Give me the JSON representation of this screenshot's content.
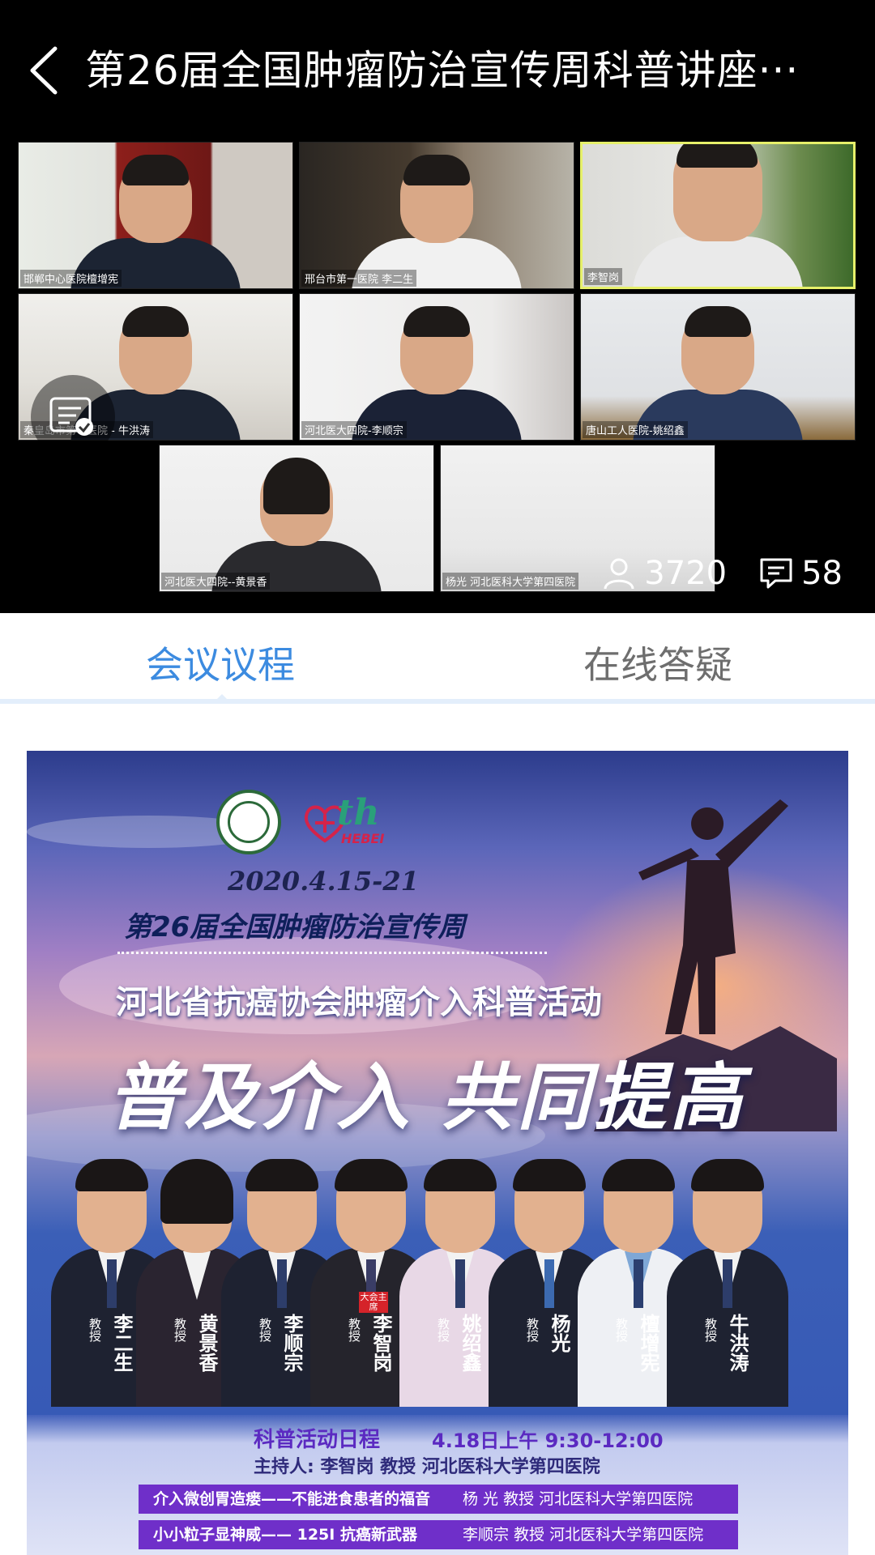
{
  "header": {
    "back_label": "返回",
    "title": "第26届全国肿瘤防治宣传周科普讲座···"
  },
  "video": {
    "tiles": [
      {
        "label": "邯郸中心医院檀增宪",
        "speaking": false
      },
      {
        "label": "邢台市第一医院 李二生",
        "speaking": false
      },
      {
        "label": "李智岗",
        "speaking": true
      },
      {
        "label": "秦皇岛市第一医院 - 牛洪涛",
        "speaking": false
      },
      {
        "label": "河北医大四院-李顺宗",
        "speaking": false
      },
      {
        "label": "唐山工人医院-姚绍鑫",
        "speaking": false
      },
      {
        "label": "河北医大四院--黄景香",
        "speaking": false
      },
      {
        "label": "杨光   河北医科大学第四医院",
        "speaking": false
      }
    ],
    "viewers": "3720",
    "comments": "58"
  },
  "tabs": [
    {
      "label": "会议议程",
      "active": true
    },
    {
      "label": "在线答疑",
      "active": false
    }
  ],
  "poster": {
    "logo_text": "th",
    "logo_sub": "HEBEI",
    "date": "2020.4.15-21",
    "week_title": "第26届全国肿瘤防治宣传周",
    "activity": "河北省抗癌协会肿瘤介入科普活动",
    "slogan": "普及介入 共同提高",
    "doctors": [
      {
        "role": "教授",
        "name": "李二生",
        "badge": ""
      },
      {
        "role": "教授",
        "name": "黄景香",
        "badge": ""
      },
      {
        "role": "教授",
        "name": "李顺宗",
        "badge": ""
      },
      {
        "role": "教授",
        "name": "李智岗",
        "badge": "大会主席"
      },
      {
        "role": "教授",
        "name": "姚绍鑫",
        "badge": ""
      },
      {
        "role": "教授",
        "name": "杨光",
        "badge": ""
      },
      {
        "role": "教授",
        "name": "檀增宪",
        "badge": ""
      },
      {
        "role": "教授",
        "name": "牛洪涛",
        "badge": ""
      }
    ],
    "schedule_title": "科普活动日程",
    "schedule_time": "4.18日上午 9:30-12:00",
    "host": "主持人: 李智岗 教授 河北医科大学第四医院",
    "talks": [
      {
        "title": "介入微创胃造瘘——不能进食患者的福音",
        "speaker": "杨 光 教授 河北医科大学第四医院"
      },
      {
        "title": "小小粒子显神威—— 125I 抗癌新武器",
        "speaker": "李顺宗 教授 河北医科大学第四医院"
      }
    ]
  },
  "colors": {
    "accent_blue": "#3c8be0",
    "speaker_border": "#e6f06a",
    "schedule_purple": "#6f2fc9"
  }
}
